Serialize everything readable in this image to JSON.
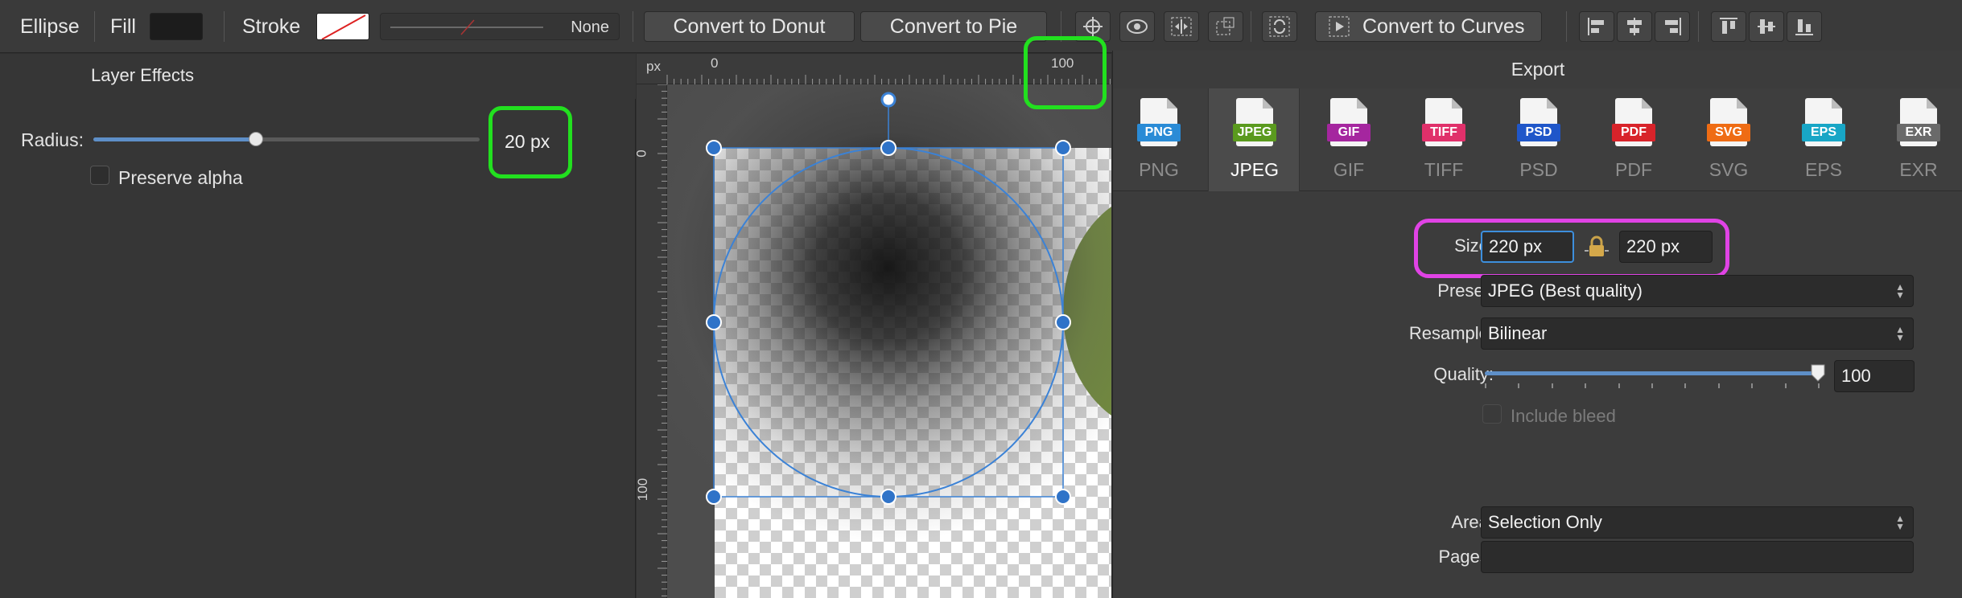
{
  "toolbar": {
    "shape_label": "Ellipse",
    "fill_label": "Fill",
    "fill_color": "#1c1c1c",
    "stroke_label": "Stroke",
    "stroke_width_value": "None",
    "convert_donut_label": "Convert to Donut",
    "convert_pie_label": "Convert to Pie",
    "convert_curves_label": "Convert to Curves",
    "icons": [
      "crosshair-icon",
      "eye-icon",
      "distribute-icon",
      "transform-icon",
      "cycle-icon",
      "play-frame-icon",
      "align-left-icon",
      "align-center-icon",
      "align-right-icon",
      "align-top-icon",
      "align-middle-icon",
      "align-bottom-icon"
    ]
  },
  "layer_effects": {
    "title": "Layer Effects",
    "radius_label": "Radius:",
    "radius_value": "20 px",
    "radius_fraction": 0.42,
    "preserve_alpha_label": "Preserve alpha",
    "preserve_alpha_checked": false
  },
  "canvas": {
    "ruler_unit": "px",
    "ruler_h_labels": [
      "0",
      "100"
    ],
    "ruler_v_labels": [
      "0",
      "100"
    ],
    "accent_color": "#3b82d6"
  },
  "export": {
    "title": "Export",
    "formats": [
      {
        "label": "PNG",
        "tag": "PNG",
        "color": "#2a8bd6",
        "selected": false
      },
      {
        "label": "JPEG",
        "tag": "JPEG",
        "color": "#5a9a1e",
        "selected": true
      },
      {
        "label": "GIF",
        "tag": "GIF",
        "color": "#a5269f",
        "selected": false
      },
      {
        "label": "TIFF",
        "tag": "TIFF",
        "color": "#e0306a",
        "selected": false
      },
      {
        "label": "PSD",
        "tag": "PSD",
        "color": "#1f56c9",
        "selected": false
      },
      {
        "label": "PDF",
        "tag": "PDF",
        "color": "#d8232a",
        "selected": false
      },
      {
        "label": "SVG",
        "tag": "SVG",
        "color": "#ef6c14",
        "selected": false
      },
      {
        "label": "EPS",
        "tag": "EPS",
        "color": "#18a6c6",
        "selected": false
      },
      {
        "label": "EXR",
        "tag": "EXR",
        "color": "#6a6a6a",
        "selected": false
      }
    ],
    "size_label": "Size:",
    "size_width": "220 px",
    "size_height": "220 px",
    "preset_label": "Preset:",
    "preset_value": "JPEG (Best quality)",
    "resample_label": "Resample:",
    "resample_value": "Bilinear",
    "quality_label": "Quality:",
    "quality_value": "100",
    "quality_fraction": 1.0,
    "include_bleed_label": "Include bleed",
    "area_label": "Area:",
    "area_value": "Selection Only",
    "pages_label": "Pages:",
    "pages_value": ""
  },
  "highlight_colors": {
    "green": "#22e01f",
    "magenta": "#e043e5"
  }
}
